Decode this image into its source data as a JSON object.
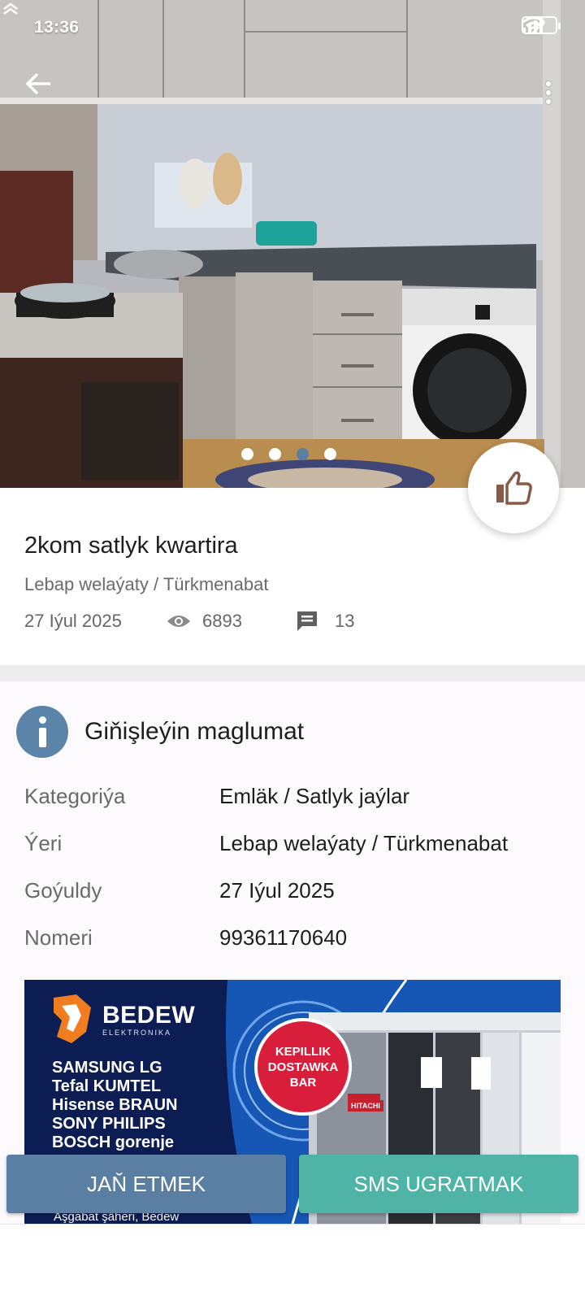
{
  "status_bar": {
    "time": "13:36",
    "battery": "47"
  },
  "gallery": {
    "image": "kitchen-photo",
    "photo_count": 4,
    "active_index": 2
  },
  "listing": {
    "title": "2kom satlyk kwartira",
    "location": "Lebap welaýaty / Türkmenabat",
    "date": "27 Iýul 2025",
    "views": "6893",
    "comments": "13"
  },
  "details": {
    "heading": "Giňişleýin maglumat",
    "rows": [
      {
        "key": "Kategoriýa",
        "value": "Emläk / Satlyk jaýlar"
      },
      {
        "key": "Ýeri",
        "value": "Lebap welaýaty / Türkmenabat"
      },
      {
        "key": "Goýuldy",
        "value": "27 Iýul 2025"
      },
      {
        "key": "Nomeri",
        "value": "99361170640"
      }
    ]
  },
  "ad": {
    "brand": "BEDEW",
    "brand_sub": "ELEKTRONIKA",
    "brands": [
      "SAMSUNG  LG",
      "Tefal KUMTEL",
      "Hisense BRAUN",
      "SONY PHILIPS",
      "BOSCH gorenje"
    ],
    "badge": [
      "KEPILLIK",
      "DOSTAWKA",
      "BAR"
    ],
    "fridge_label": "HITACHI",
    "address": "Aşgabat şäheri, Bedew"
  },
  "actions": {
    "call": "JAŇ ETMEK",
    "sms": "SMS UGRATMAK"
  },
  "colors": {
    "primary": "#5b7fa3",
    "secondary": "#4fb3a5",
    "info": "#5b84a8",
    "badge": "#d91e3c"
  },
  "icons": {
    "back": "arrow-left-icon",
    "more": "more-vert-icon",
    "like": "thumbs-up-icon",
    "views": "eye-icon",
    "comments": "comment-icon",
    "info": "info-icon"
  }
}
